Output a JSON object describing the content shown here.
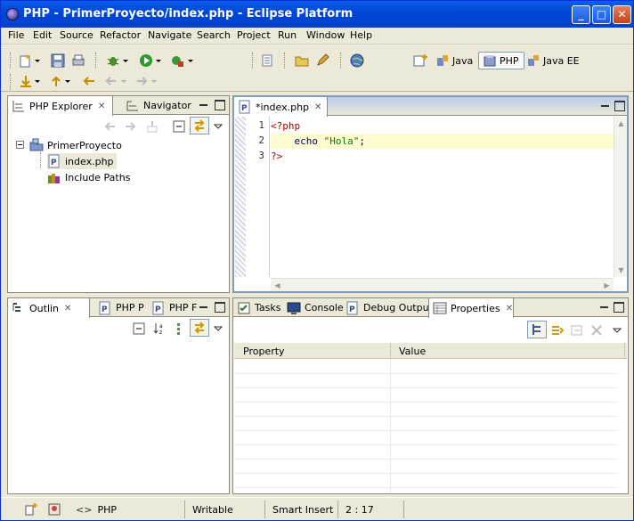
{
  "window": {
    "title": "PHP - PrimerProyecto/index.php - Eclipse Platform",
    "controls": {
      "minimize": "_",
      "maximize": "□",
      "close": "✕"
    }
  },
  "menu": [
    "File",
    "Edit",
    "Source",
    "Refactor",
    "Navigate",
    "Search",
    "Project",
    "Run",
    "Window",
    "Help"
  ],
  "perspectives": [
    {
      "label": "Java",
      "icon": "java-perspective-icon",
      "selected": false
    },
    {
      "label": "PHP",
      "icon": "php-perspective-icon",
      "selected": true
    },
    {
      "label": "Java EE",
      "icon": "javaee-perspective-icon",
      "selected": false
    }
  ],
  "explorer": {
    "tabs": [
      {
        "label": "PHP Explorer",
        "close": "✕"
      },
      {
        "label": "Navigator"
      }
    ],
    "project": "PrimerProyecto",
    "children": [
      "index.php",
      "Include Paths"
    ]
  },
  "editor": {
    "tab": {
      "label": "*index.php",
      "close": "✕"
    },
    "line_numbers": [
      "1",
      "2",
      "3"
    ],
    "lines": [
      [
        {
          "t": "<?php",
          "c": "#b40000"
        }
      ],
      [
        {
          "t": "    echo ",
          "c": "#000080"
        },
        {
          "t": "\"Hola\"",
          "c": "#008000"
        },
        {
          "t": ";",
          "c": "#000000"
        }
      ],
      [
        {
          "t": "?>",
          "c": "#b40000"
        }
      ]
    ],
    "highlight_line": 2,
    "colors": {
      "highlight": "#fffbd0",
      "php_tag": "#b40000"
    }
  },
  "outline": {
    "tabs": [
      {
        "label": "Outlin",
        "close": "✕"
      },
      {
        "label": "PHP P"
      },
      {
        "label": "PHP F"
      }
    ]
  },
  "bottom": {
    "tabs": [
      {
        "label": "Tasks"
      },
      {
        "label": "Console"
      },
      {
        "label": "Debug Output"
      },
      {
        "label": "Properties",
        "close": "✕"
      }
    ],
    "columns": [
      "Property",
      "Value"
    ]
  },
  "status": {
    "lang_prefix": "<>",
    "language": "PHP",
    "mode": "Writable",
    "insert": "Smart Insert",
    "position": "2 : 17"
  },
  "colors": {
    "titlebar": "#0054e3",
    "panel_bg": "#ece9d8",
    "accent_border": "#7f9db9"
  }
}
